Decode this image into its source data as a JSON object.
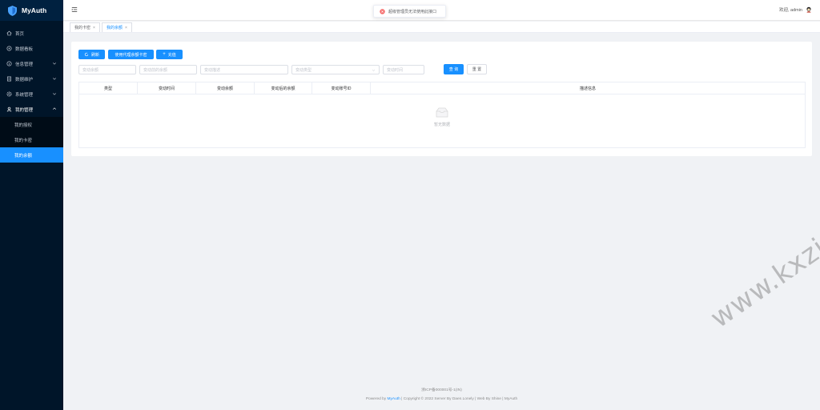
{
  "app": {
    "name": "MyAuth"
  },
  "sidebar": {
    "items": [
      {
        "label": "首页",
        "icon": "home-icon",
        "has_arrow": false
      },
      {
        "label": "数据看板",
        "icon": "dashboard-icon",
        "has_arrow": false
      },
      {
        "label": "信息管理",
        "icon": "info-icon",
        "has_arrow": true
      },
      {
        "label": "数据维护",
        "icon": "document-icon",
        "has_arrow": true
      },
      {
        "label": "系统管理",
        "icon": "gear-icon",
        "has_arrow": true
      },
      {
        "label": "我的管理",
        "icon": "user-icon",
        "has_arrow": true,
        "expanded": true
      }
    ],
    "subitems": [
      {
        "label": "我的授权",
        "active": false
      },
      {
        "label": "我的卡密",
        "active": false
      },
      {
        "label": "我的余额",
        "active": true
      }
    ]
  },
  "header": {
    "welcome": "欢迎, admin"
  },
  "tabs": [
    {
      "label": "我的卡密",
      "close": "×",
      "active": false
    },
    {
      "label": "我的余额",
      "close": "×",
      "active": true
    }
  ],
  "toast": {
    "text": "超级管理员无法使用此接口",
    "type": "error"
  },
  "toolbar": {
    "refresh_label": "刷新",
    "use_card_label": "使用代理余额卡密",
    "recharge_label": "充值"
  },
  "filters": {
    "amount_placeholder": "变动余额",
    "before_placeholder": "变动前的余额",
    "desc_placeholder": "变动描述",
    "type_placeholder": "变动类型",
    "time_placeholder": "变动时间",
    "search_label": "查 询",
    "reset_label": "重 置"
  },
  "table": {
    "columns": [
      "类型",
      "变动时间",
      "变动余额",
      "变动后的余额",
      "变动账号ID",
      "描述信息"
    ],
    "empty_text": "暂无数据"
  },
  "footer": {
    "icp": "浙ICP备000001号-1(IN)",
    "powered_prefix": "Powered by ",
    "powered_link": "MyAuth",
    "rest": " | Copyright © 2022 Server By Daen.Lonely | Web By Shine | MyAuth"
  },
  "watermark": "www.kxzi.cn",
  "colors": {
    "accent": "#1890ff",
    "sidebar_bg": "#001529",
    "error": "#f56c6c"
  }
}
